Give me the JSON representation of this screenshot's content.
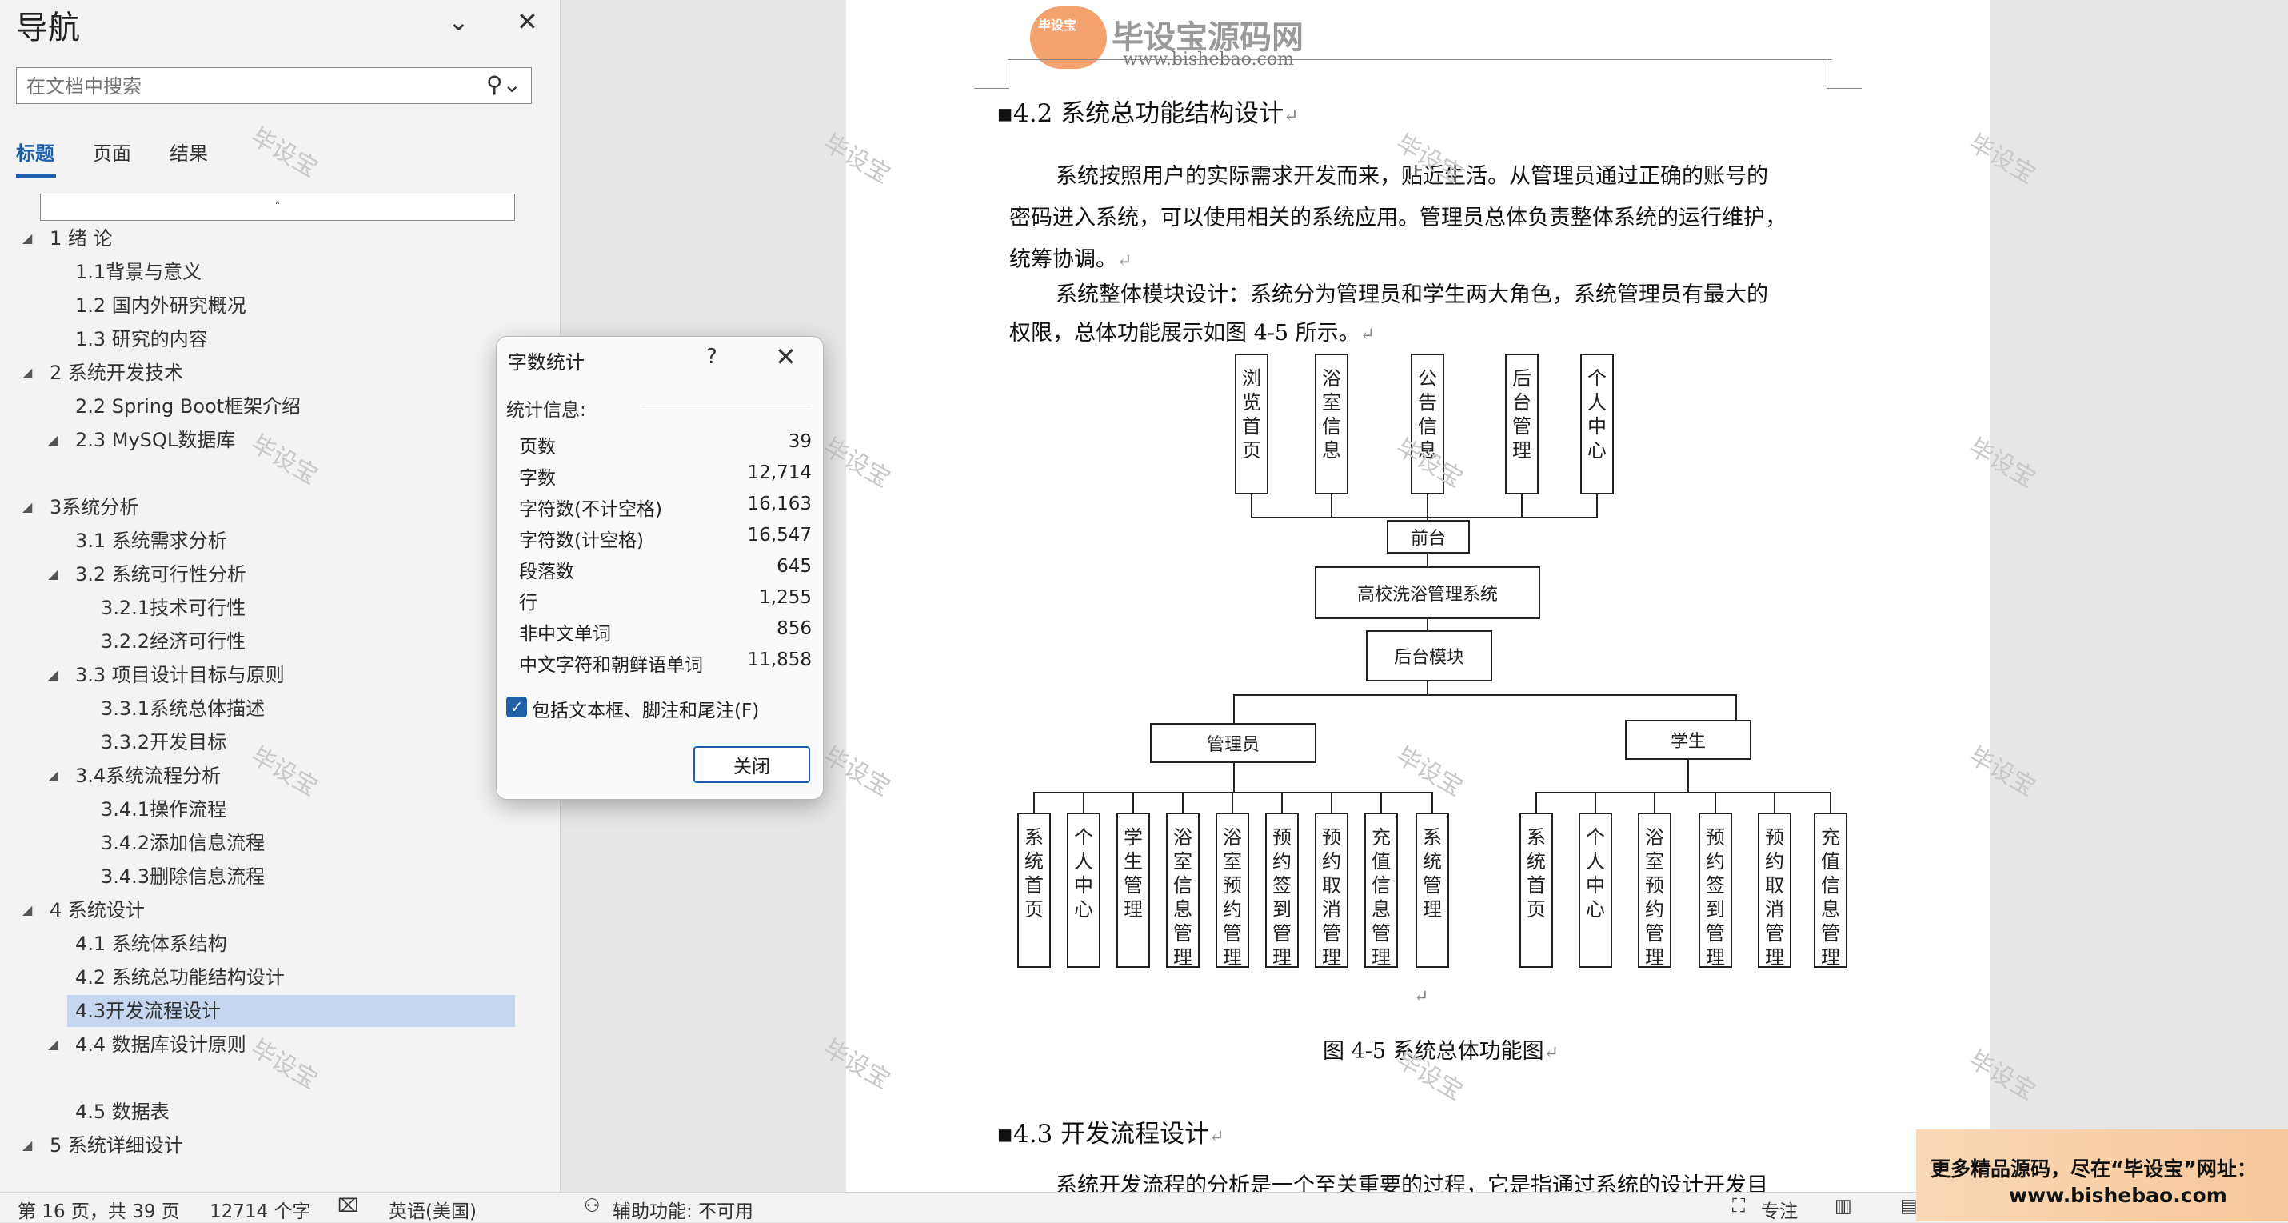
{
  "nav": {
    "title": "导航",
    "search_placeholder": "在文档中搜索",
    "tabs": [
      "标题",
      "页面",
      "结果"
    ],
    "collapse_symbol": "˄",
    "toc": [
      {
        "label": "1 绪  论",
        "level": 1,
        "arrow": "◢"
      },
      {
        "label": "1.1背景与意义",
        "level": 2
      },
      {
        "label": "1.2 国内外研究概况",
        "level": 2
      },
      {
        "label": "1.3 研究的内容",
        "level": 2
      },
      {
        "label": "2 系统开发技术",
        "level": 1,
        "arrow": "◢"
      },
      {
        "label": "2.2 Spring Boot框架介绍",
        "level": 2
      },
      {
        "label": "2.3 MySQL数据库",
        "level": 2,
        "arrow": "◢"
      },
      {
        "label": "3系统分析",
        "level": 1,
        "arrow": "◢"
      },
      {
        "label": "3.1 系统需求分析",
        "level": 2
      },
      {
        "label": "3.2 系统可行性分析",
        "level": 2,
        "arrow": "◢"
      },
      {
        "label": "3.2.1技术可行性",
        "level": 3
      },
      {
        "label": "3.2.2经济可行性",
        "level": 3
      },
      {
        "label": "3.3 项目设计目标与原则",
        "level": 2,
        "arrow": "◢"
      },
      {
        "label": "3.3.1系统总体描述",
        "level": 3
      },
      {
        "label": "3.3.2开发目标",
        "level": 3
      },
      {
        "label": "3.4系统流程分析",
        "level": 2,
        "arrow": "◢"
      },
      {
        "label": "3.4.1操作流程",
        "level": 3
      },
      {
        "label": "3.4.2添加信息流程",
        "level": 3
      },
      {
        "label": "3.4.3删除信息流程",
        "level": 3
      },
      {
        "label": "4 系统设计",
        "level": 1,
        "arrow": "◢"
      },
      {
        "label": "4.1 系统体系结构",
        "level": 2
      },
      {
        "label": "4.2 系统总功能结构设计",
        "level": 2
      },
      {
        "label": "4.3开发流程设计",
        "level": 2,
        "selected": true
      },
      {
        "label": "4.4 数据库设计原则",
        "level": 2,
        "arrow": "◢"
      },
      {
        "label": "4.5 数据表",
        "level": 2
      },
      {
        "label": "5 系统详细设计",
        "level": 1,
        "arrow": "◢"
      }
    ]
  },
  "watermark": "毕设宝",
  "logo": {
    "badge": "毕设宝",
    "name": "毕设宝源码网",
    "url": "www.bishebao.com"
  },
  "document": {
    "heading_42": "4.2  系统总功能结构设计",
    "para1_line1": "系统按照用户的实际需求开发而来，贴近生活。从管理员通过正确的账号的",
    "para1_line2": "密码进入系统，可以使用相关的系统应用。管理员总体负责整体系统的运行维护，",
    "para1_line3": "统筹协调。",
    "para2_line1": "系统整体模块设计：系统分为管理员和学生两大角色，系统管理员有最大的",
    "para2_line2": "权限，总体功能展示如图 4-5 所示。",
    "figure_caption": "图 4-5  系统总体功能图",
    "heading_43": "4.3 开发流程设计",
    "para3_line1": "系统开发流程的分析是一个至关重要的过程，它是指通过系统的设计开发目",
    "pilcrow": "↵"
  },
  "diagram": {
    "top_boxes": [
      "浏览首页",
      "浴室信息",
      "公告信息",
      "后台管理",
      "个人中心"
    ],
    "front": "前台",
    "system": "高校洗浴管理系统",
    "backend": "后台模块",
    "admin": "管理员",
    "student": "学生",
    "admin_boxes": [
      "系统首页",
      "个人中心",
      "学生管理",
      "浴室信息管理",
      "浴室预约管理",
      "预约签到管理",
      "预约取消管理",
      "充值信息管理",
      "系统管理"
    ],
    "student_boxes": [
      "系统首页",
      "个人中心",
      "浴室预约管理",
      "预约签到管理",
      "预约取消管理",
      "充值信息管理"
    ]
  },
  "dialog": {
    "title": "字数统计",
    "help": "?",
    "close_x": "✕",
    "section": "统计信息:",
    "stats": [
      {
        "label": "页数",
        "value": "39"
      },
      {
        "label": "字数",
        "value": "12,714"
      },
      {
        "label": "字符数(不计空格)",
        "value": "16,163"
      },
      {
        "label": "字符数(计空格)",
        "value": "16,547"
      },
      {
        "label": "段落数",
        "value": "645"
      },
      {
        "label": "行",
        "value": "1,255"
      },
      {
        "label": "非中文单词",
        "value": "856"
      },
      {
        "label": "中文字符和朝鲜语单词",
        "value": "11,858"
      }
    ],
    "checkbox_checked": true,
    "checkbox_label": "包括文本框、脚注和尾注(F)",
    "close_button": "关闭"
  },
  "status": {
    "page": "第 16 页，共 39 页",
    "words": "12714 个字",
    "language": "英语(美国)",
    "accessibility": "辅助功能: 不可用",
    "focus": "专注"
  },
  "ad": {
    "line1": "更多精品源码，尽在“毕设宝”网址：",
    "line2": "www.bishebao.com"
  },
  "colors": {
    "accent": "#1f5fa8",
    "selected_bg": "#c5d6f1",
    "ad_bg": "#f6c79a"
  }
}
